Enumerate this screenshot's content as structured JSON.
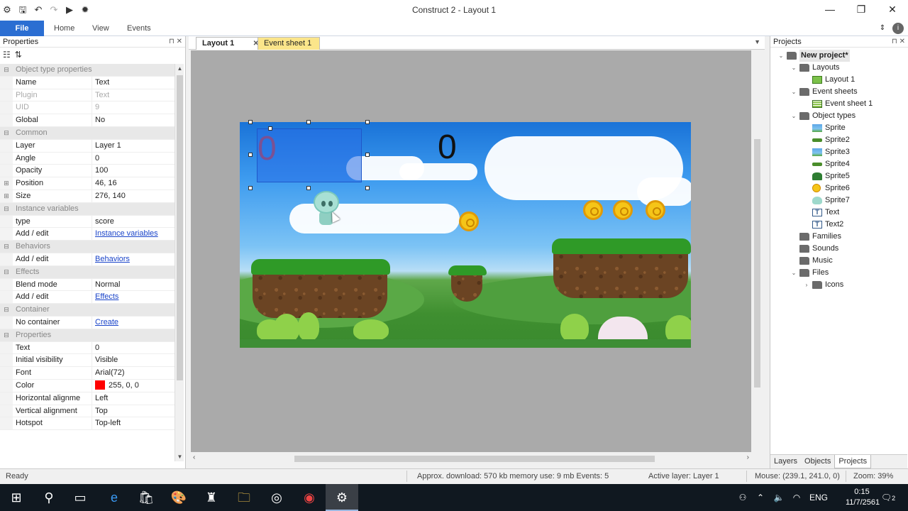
{
  "window": {
    "title": "Construct 2 - Layout 1"
  },
  "ribbon": {
    "tabs": [
      "File",
      "Home",
      "View",
      "Events"
    ]
  },
  "properties": {
    "title": "Properties",
    "rows": [
      {
        "kind": "cat",
        "name": "Object type properties"
      },
      {
        "name": "Name",
        "value": "Text"
      },
      {
        "name": "Plugin",
        "value": "Text",
        "dim": true
      },
      {
        "name": "UID",
        "value": "9",
        "dim": true
      },
      {
        "name": "Global",
        "value": "No"
      },
      {
        "kind": "cat",
        "name": "Common"
      },
      {
        "name": "Layer",
        "value": "Layer 1"
      },
      {
        "name": "Angle",
        "value": "0"
      },
      {
        "name": "Opacity",
        "value": "100"
      },
      {
        "name": "Position",
        "value": "46, 16",
        "expand": true
      },
      {
        "name": "Size",
        "value": "276, 140",
        "expand": true
      },
      {
        "kind": "cat",
        "name": "Instance variables"
      },
      {
        "name": "type",
        "value": "score"
      },
      {
        "name": "Add / edit",
        "value": "Instance variables",
        "link": true
      },
      {
        "kind": "cat",
        "name": "Behaviors"
      },
      {
        "name": "Add / edit",
        "value": "Behaviors",
        "link": true
      },
      {
        "kind": "cat",
        "name": "Effects"
      },
      {
        "name": "Blend mode",
        "value": "Normal"
      },
      {
        "name": "Add / edit",
        "value": "Effects",
        "link": true
      },
      {
        "kind": "cat",
        "name": "Container"
      },
      {
        "name": "No container",
        "value": "Create",
        "link": true
      },
      {
        "kind": "cat",
        "name": "Properties"
      },
      {
        "name": "Text",
        "value": "0"
      },
      {
        "name": "Initial visibility",
        "value": "Visible"
      },
      {
        "name": "Font",
        "value": "Arial(72)"
      },
      {
        "name": "Color",
        "value": "255, 0, 0",
        "swatch": "#ff0000"
      },
      {
        "name": "Horizontal alignme",
        "value": "Left"
      },
      {
        "name": "Vertical alignment",
        "value": "Top"
      },
      {
        "name": "Hotspot",
        "value": "Top-left"
      }
    ]
  },
  "doc_tabs": [
    {
      "label": "Layout 1",
      "active": true
    },
    {
      "label": "Event sheet 1",
      "active": false
    }
  ],
  "layout": {
    "score_text_1": "0",
    "score_text_2": "0"
  },
  "projects": {
    "title": "Projects",
    "tree": [
      {
        "label": "New project*",
        "level": 0,
        "open": true,
        "icon": "folder",
        "bold": true
      },
      {
        "label": "Layouts",
        "level": 1,
        "open": true,
        "icon": "folder"
      },
      {
        "label": "Layout 1",
        "level": 2,
        "icon": "layout"
      },
      {
        "label": "Event sheets",
        "level": 1,
        "open": true,
        "icon": "folder"
      },
      {
        "label": "Event sheet 1",
        "level": 2,
        "icon": "events"
      },
      {
        "label": "Object types",
        "level": 1,
        "open": true,
        "icon": "folder"
      },
      {
        "label": "Sprite",
        "level": 2,
        "icon": "bg"
      },
      {
        "label": "Sprite2",
        "level": 2,
        "icon": "plat"
      },
      {
        "label": "Sprite3",
        "level": 2,
        "icon": "bg"
      },
      {
        "label": "Sprite4",
        "level": 2,
        "icon": "plat"
      },
      {
        "label": "Sprite5",
        "level": 2,
        "icon": "tree"
      },
      {
        "label": "Sprite6",
        "level": 2,
        "icon": "coin"
      },
      {
        "label": "Sprite7",
        "level": 2,
        "icon": "alien"
      },
      {
        "label": "Text",
        "level": 2,
        "icon": "text"
      },
      {
        "label": "Text2",
        "level": 2,
        "icon": "text"
      },
      {
        "label": "Families",
        "level": 1,
        "icon": "folder"
      },
      {
        "label": "Sounds",
        "level": 1,
        "icon": "folder"
      },
      {
        "label": "Music",
        "level": 1,
        "icon": "folder"
      },
      {
        "label": "Files",
        "level": 1,
        "open": true,
        "icon": "folder"
      },
      {
        "label": "Icons",
        "level": 2,
        "icon": "folder",
        "collapsed": true
      }
    ],
    "bottom_tabs": [
      "Layers",
      "Objects",
      "Projects"
    ]
  },
  "status": {
    "ready": "Ready",
    "download": "Approx. download: 570 kb  memory use: 9 mb  Events: 5",
    "active_layer": "Active layer: Layer 1",
    "mouse": "Mouse: (239.1, 241.0, 0)",
    "zoom": "Zoom: 39%"
  },
  "taskbar": {
    "lang": "ENG",
    "time": "0:15",
    "date": "11/7/2561",
    "notif_count": "2"
  }
}
